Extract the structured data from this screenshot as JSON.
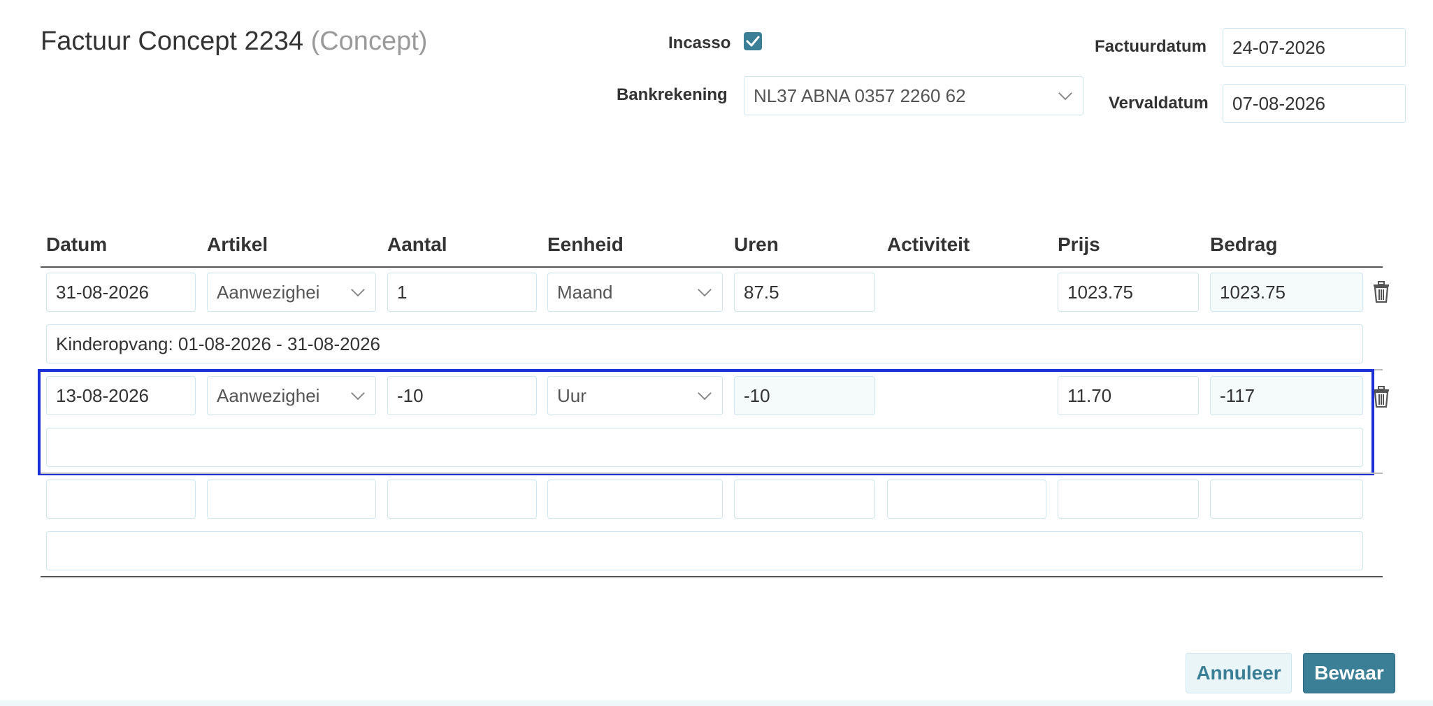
{
  "header": {
    "title": "Factuur Concept 2234",
    "status": "(Concept)",
    "incasso_label": "Incasso",
    "incasso_checked": true,
    "bank_label": "Bankrekening",
    "bank_value": "NL37 ABNA 0357 2260 62",
    "invoice_date_label": "Factuurdatum",
    "invoice_date": "24-07-2026",
    "due_date_label": "Vervaldatum",
    "due_date": "07-08-2026"
  },
  "table": {
    "columns": [
      "Datum",
      "Artikel",
      "Aantal",
      "Eenheid",
      "Uren",
      "Activiteit",
      "Prijs",
      "Bedrag"
    ],
    "rows": [
      {
        "datum": "31-08-2026",
        "artikel": "Aanwezighei",
        "aantal": "1",
        "eenheid": "Maand",
        "uren": "87.5",
        "prijs": "1023.75",
        "bedrag": "1023.75",
        "omschrijving": "Kinderopvang: 01-08-2026 - 31-08-2026"
      },
      {
        "datum": "13-08-2026",
        "artikel": "Aanwezighei",
        "aantal": "-10",
        "eenheid": "Uur",
        "uren": "-10",
        "prijs": "11.70",
        "bedrag": "-117",
        "omschrijving": ""
      }
    ]
  },
  "actions": {
    "cancel_label": "Annuleer",
    "save_label": "Bewaar"
  },
  "colors": {
    "accent": "#3a7f96",
    "selection": "#1a2fd6",
    "field_border": "#cfe6ee"
  }
}
